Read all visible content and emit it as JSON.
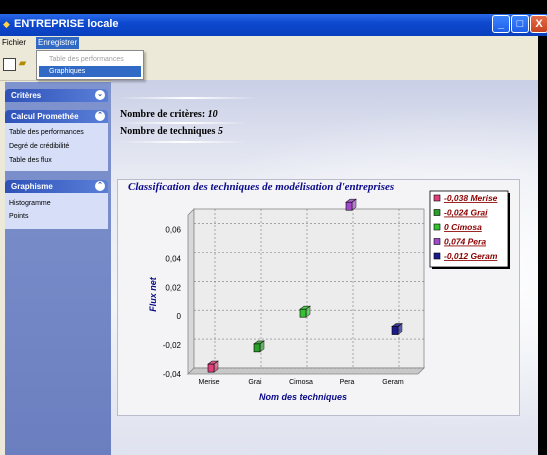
{
  "window": {
    "title": "ENTREPRISE locale",
    "buttons": [
      "_",
      "□",
      "X"
    ]
  },
  "menubar": {
    "items": [
      "Fichier",
      "Enregistrer"
    ]
  },
  "menu_dropdown": {
    "items": [
      {
        "label": "Table des performances",
        "enabled": false
      },
      {
        "label": "Graphiques",
        "enabled": true,
        "selected": true
      }
    ]
  },
  "sidebar": {
    "panels": [
      {
        "title": "Critères",
        "items": []
      },
      {
        "title": "Calcul Promethée",
        "items": [
          "Table des performances",
          "Degré de crédibilité",
          "Table des flux"
        ]
      },
      {
        "title": "Graphisme",
        "items": [
          "Histogramme",
          "Points"
        ]
      }
    ]
  },
  "info": {
    "criteria_label": "Nombre de critères:",
    "criteria_value": "10",
    "techniques_label": "Nombre de techniques",
    "techniques_value": "5"
  },
  "chart_data": {
    "type": "scatter",
    "title": "Classification des techniques de modélisation d'entreprises",
    "xlabel": "Nom des techniques",
    "ylabel": "Flux net",
    "categories": [
      "Merise",
      "Grai",
      "Cimosa",
      "Pera",
      "Geram"
    ],
    "values": [
      -0.038,
      -0.024,
      0,
      0.074,
      -0.012
    ],
    "ytick_labels": [
      "-0,04",
      "-0,02",
      "0",
      "0,02",
      "0,04",
      "0,06"
    ],
    "ylim": [
      -0.04,
      0.07
    ],
    "grid": true,
    "legend_position": "top-right",
    "legend": [
      {
        "label": "-0,038 Merise",
        "color": "#e0407a"
      },
      {
        "label": "-0,024 Grai",
        "color": "#2aa02a"
      },
      {
        "label": "0 Cimosa",
        "color": "#33c233"
      },
      {
        "label": "0,074 Pera",
        "color": "#a04ac8"
      },
      {
        "label": "-0,012 Geram",
        "color": "#1a1a8c"
      }
    ],
    "colors": [
      "#e0407a",
      "#2aa02a",
      "#33c233",
      "#a04ac8",
      "#1a1a8c"
    ]
  }
}
